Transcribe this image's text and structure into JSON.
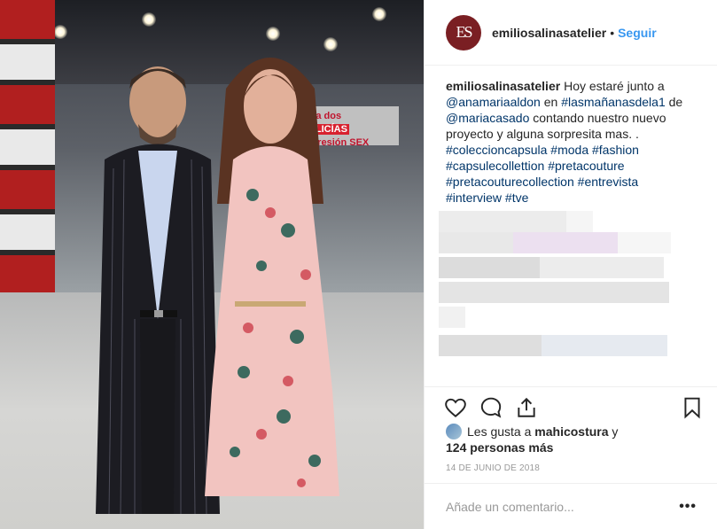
{
  "post": {
    "author": "emiliosalinasatelier",
    "avatar_initials": "ES",
    "follow_label": "Seguir",
    "separator": "•",
    "caption": {
      "lines": [
        [
          {
            "t": "emiliosalinasatelier",
            "k": "user"
          },
          {
            "t": " Hoy estaré junto a",
            "k": "text"
          }
        ],
        [
          {
            "t": "@anamariaaldon",
            "k": "link"
          },
          {
            "t": " en ",
            "k": "text"
          },
          {
            "t": "#lasmañanasdela1",
            "k": "link"
          },
          {
            "t": " de",
            "k": "text"
          }
        ],
        [
          {
            "t": "@mariacasado",
            "k": "link"
          },
          {
            "t": " contando nuestro nuevo",
            "k": "text"
          }
        ],
        [
          {
            "t": "proyecto y alguna sorpresita mas. .",
            "k": "text"
          }
        ],
        [
          {
            "t": "#coleccioncapsula",
            "k": "link"
          },
          {
            "t": " ",
            "k": "text"
          },
          {
            "t": "#moda",
            "k": "link"
          },
          {
            "t": " ",
            "k": "text"
          },
          {
            "t": "#fashion",
            "k": "link"
          }
        ],
        [
          {
            "t": "#capsulecollettion",
            "k": "link"
          },
          {
            "t": " ",
            "k": "text"
          },
          {
            "t": "#pretacouture",
            "k": "link"
          }
        ],
        [
          {
            "t": "#pretacouturecollection",
            "k": "link"
          },
          {
            "t": " ",
            "k": "text"
          },
          {
            "t": "#entrevista",
            "k": "link"
          }
        ],
        [
          {
            "t": "#interview",
            "k": "link"
          },
          {
            "t": " ",
            "k": "text"
          },
          {
            "t": "#tve",
            "k": "link"
          }
        ]
      ]
    },
    "photo_screen_text": {
      "line1_prefix": "cia a dos ",
      "line1_highlight": "POLICÍAS",
      "line2": "r agresión SEX"
    },
    "likes": {
      "prefix": "Les gusta a ",
      "user": "mahicostura",
      "suffix": " y",
      "count": "124 personas más"
    },
    "date": "14 DE JUNIO DE 2018",
    "comment": {
      "placeholder": "Añade un comentario...",
      "more": "•••"
    }
  },
  "icons": {
    "like": "heart-icon",
    "comment": "comment-bubble-icon",
    "share": "share-icon",
    "save": "bookmark-icon"
  },
  "colors": {
    "link": "#003569",
    "follow": "#3897f0",
    "muted": "#999999",
    "text": "#262626"
  }
}
